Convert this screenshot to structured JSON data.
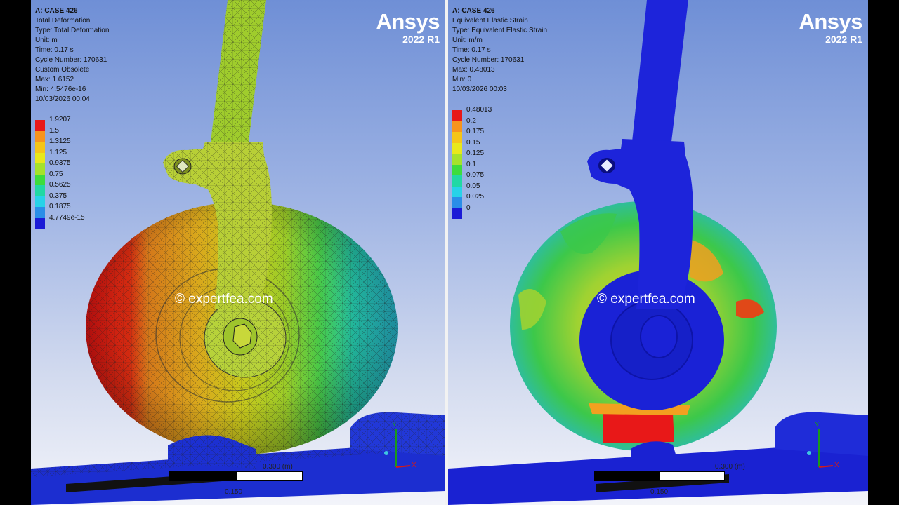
{
  "left": {
    "info": {
      "case": "A: CASE 426",
      "name": "Total Deformation",
      "type": "Type: Total Deformation",
      "unit": "Unit: m",
      "time": "Time: 0.17 s",
      "cycle": "Cycle Number: 170631",
      "custom": "Custom Obsolete",
      "max": "Max: 1.6152",
      "min": "Min: 4.5476e-16",
      "date": "10/03/2026 00:04"
    },
    "legend": [
      {
        "label": "1.9207",
        "color": "#e81818"
      },
      {
        "label": "1.5",
        "color": "#f7941d"
      },
      {
        "label": "1.3125",
        "color": "#f5c518"
      },
      {
        "label": "1.125",
        "color": "#e8e81b"
      },
      {
        "label": "0.9375",
        "color": "#a5e22b"
      },
      {
        "label": "0.75",
        "color": "#3ddc3d"
      },
      {
        "label": "0.5625",
        "color": "#21d8a4"
      },
      {
        "label": "0.375",
        "color": "#27d2e8"
      },
      {
        "label": "0.1875",
        "color": "#2a8ee8"
      },
      {
        "label": "4.7749e-15",
        "color": "#1b1bd6"
      }
    ],
    "watermark": "© expertfea.com",
    "scale_label_top": "0.300 (m)",
    "scale_label_bottom": "0.150"
  },
  "right": {
    "info": {
      "case": "A: CASE 426",
      "name": "Equivalent Elastic Strain",
      "type": "Type: Equivalent Elastic Strain",
      "unit": "Unit: m/m",
      "time": "Time: 0.17 s",
      "cycle": "Cycle Number: 170631",
      "max": "Max: 0.48013",
      "min": "Min: 0",
      "date": "10/03/2026 00:03"
    },
    "legend": [
      {
        "label": "0.48013",
        "color": "#e81818"
      },
      {
        "label": "0.2",
        "color": "#f7941d"
      },
      {
        "label": "0.175",
        "color": "#f5c518"
      },
      {
        "label": "0.15",
        "color": "#e8e81b"
      },
      {
        "label": "0.125",
        "color": "#a5e22b"
      },
      {
        "label": "0.1",
        "color": "#3ddc3d"
      },
      {
        "label": "0.075",
        "color": "#21d8a4"
      },
      {
        "label": "0.05",
        "color": "#27d2e8"
      },
      {
        "label": "0.025",
        "color": "#2a8ee8"
      },
      {
        "label": "0",
        "color": "#1b1bd6"
      }
    ],
    "watermark": "© expertfea.com",
    "scale_label_top": "0.300 (m)",
    "scale_label_bottom": "0.150"
  },
  "brand": "Ansys",
  "version": "2022 R1",
  "axis": {
    "y": "Y",
    "x": "X"
  }
}
